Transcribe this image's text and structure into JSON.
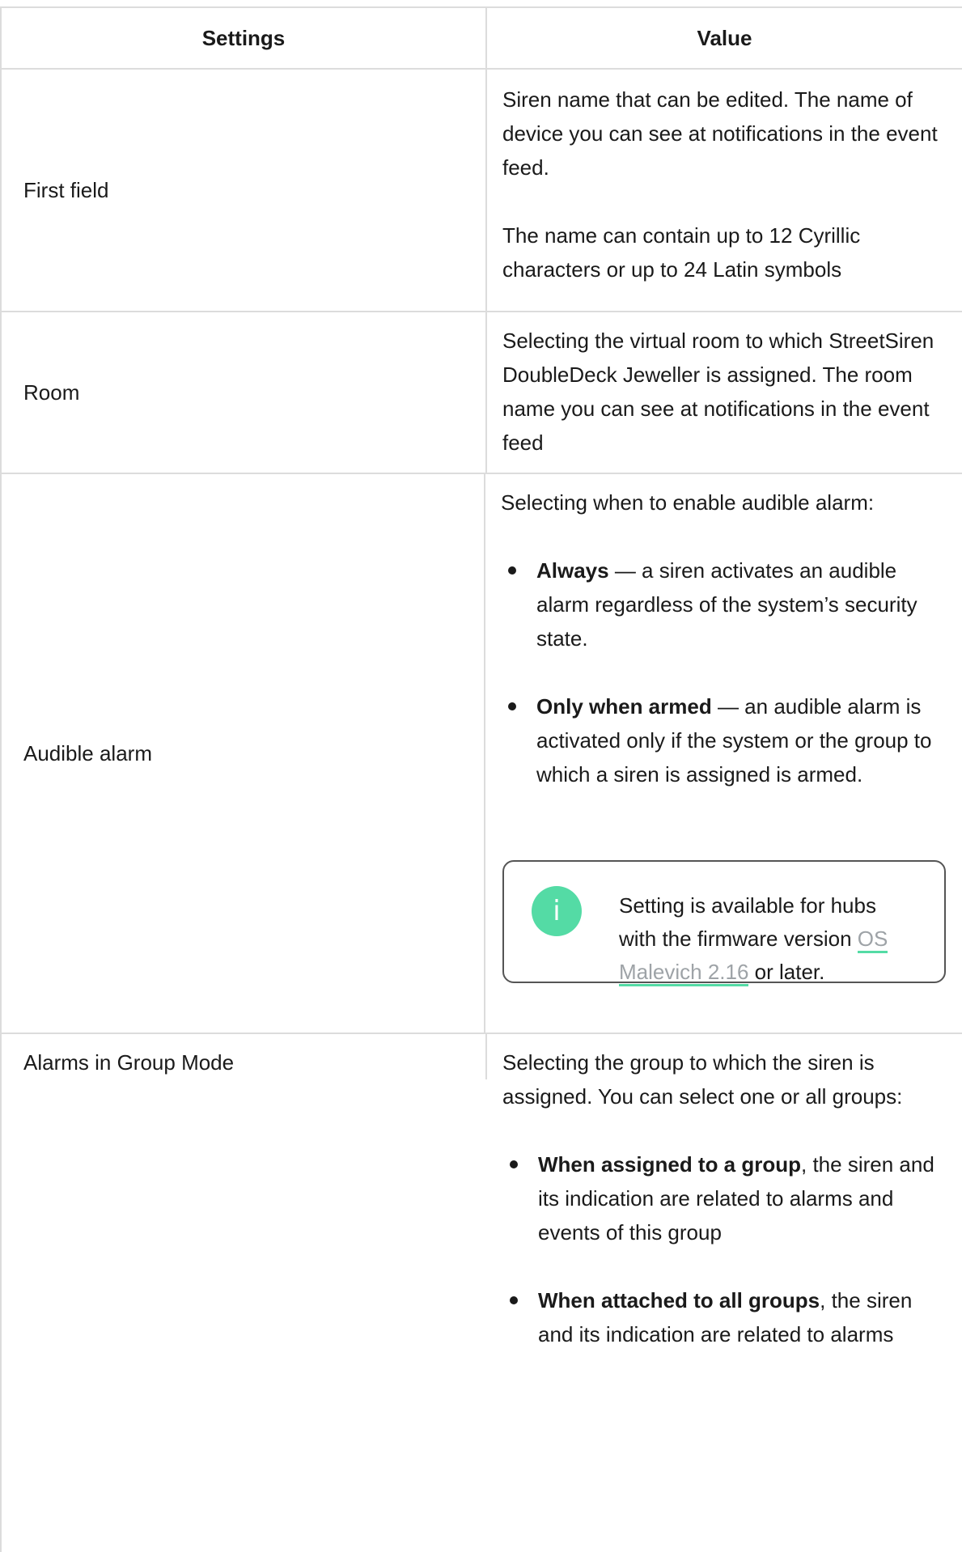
{
  "table": {
    "header": {
      "settings": "Settings",
      "value": "Value"
    },
    "rows": {
      "first_field": {
        "setting": "First field",
        "p1": "Siren name that can be edited. The name of device you can see at notifications in the event feed.",
        "p2": "The name can contain up to 12 Cyrillic characters or up to 24 Latin symbols"
      },
      "room": {
        "setting": "Room",
        "p1": "Selecting the virtual room to which StreetSiren DoubleDeck Jeweller is assigned. The room name you can see at notifications in the event feed"
      },
      "audible_alarm": {
        "setting": "Audible alarm",
        "intro": "Selecting when to enable audible alarm:",
        "bullets": [
          {
            "bold": "Always",
            "text": " — a siren activates an audible alarm regardless of the system’s security state."
          },
          {
            "bold": "Only when armed",
            "text": " — an audible alarm is activated only if the system or the group to which a siren is assigned is armed."
          }
        ],
        "note": {
          "icon": "i",
          "text_before": "Setting is available for hubs with the firmware version ",
          "link": "OS Malevich 2.16",
          "text_after": " or later."
        }
      },
      "alarms_group": {
        "setting": "Alarms in Group Mode",
        "intro": "Selecting the group to which the siren is assigned. You can select one or all groups:",
        "bullets": [
          {
            "bold": "When assigned to a group",
            "text": ", the siren and its indication are related to alarms and events of this group"
          },
          {
            "bold": "When attached to all groups",
            "text": ", the siren and its indication are related to alarms"
          }
        ]
      }
    }
  },
  "colors": {
    "accent": "#54dba5",
    "link": "#9ea3a7",
    "border": "#dcdcdc",
    "text": "#1a1a1a"
  }
}
